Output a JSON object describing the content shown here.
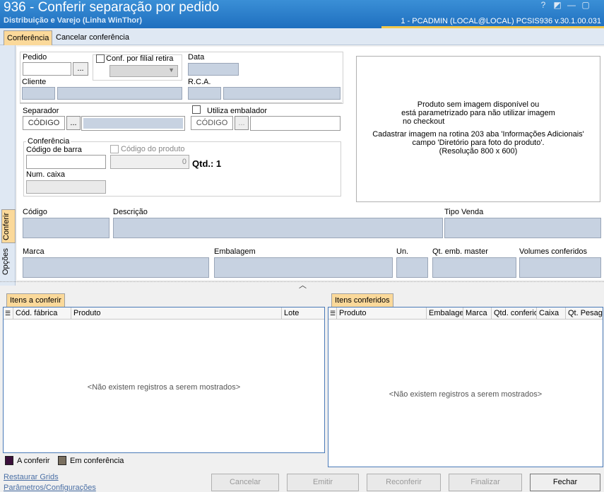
{
  "window": {
    "title": "936 - Conferir separação por pedido",
    "subtitle": "Distribuição e Varejo (Linha WinThor)",
    "session": "1 - PCADMIN (LOCAL@LOCAL)   PCSIS936  v.30.1.00.031",
    "controls": [
      "?",
      "◩",
      "—",
      "▢"
    ]
  },
  "top_tabs": [
    "Conferência",
    "Cancelar conferência"
  ],
  "side_tabs": [
    "Conferir",
    "Opções"
  ],
  "form": {
    "pedido_label": "Pedido",
    "conf_filial_label": "Conf. por filial retira",
    "data_label": "Data",
    "cliente_label": "Cliente",
    "rca_label": "R.C.A.",
    "separador_label": "Separador",
    "separador_codigo": "CÓDIGO",
    "utiliza_embalador_label": "Utiliza embalador",
    "embalador_codigo": "CÓDIGO",
    "conferencia_group": "Conferência",
    "codigo_barra_label": "Código de barra",
    "codigo_produto_label": "Código do produto",
    "codigo_produto_value": "0",
    "qtd_label": "Qtd.: 1",
    "num_caixa_label": "Num. caixa",
    "dots": "...",
    "codigo_label": "Código",
    "descricao_label": "Descrição",
    "tipo_venda_label": "Tipo Venda",
    "marca_label": "Marca",
    "embalagem_label": "Embalagem",
    "un_label": "Un.",
    "qt_emb_master_label": "Qt. emb. master",
    "volumes_conferidos_label": "Volumes conferidos"
  },
  "image_box": {
    "line1": "Produto sem imagem disponível ou",
    "line2": "está parametrizado para não utilizar imagem",
    "line3": "no checkout",
    "line4": "Cadastrar imagem na rotina 203 aba 'Informações Adicionais'",
    "line5": "campo 'Diretório para foto do produto'.",
    "line6": "(Resolução 800 x 600)"
  },
  "grid_left": {
    "tab": "Itens a conferir",
    "columns": [
      "Cód. fábrica",
      "Produto",
      "Lote"
    ],
    "empty": "<Não existem registros a serem mostrados>"
  },
  "grid_right": {
    "tab": "Itens conferidos",
    "columns": [
      "Produto",
      "Embalagem",
      "Marca",
      "Qtd. conferida",
      "Caixa",
      "Qt. Pesagem"
    ],
    "empty": "<Não existem registros a serem mostrados>"
  },
  "legend": [
    {
      "label": "A conferir",
      "color": "#3a0f3a"
    },
    {
      "label": "Em conferência",
      "color": "#7a7060"
    }
  ],
  "links": [
    "Restaurar Grids",
    "Parâmetros/Configurações"
  ],
  "buttons": [
    "Cancelar",
    "Emitir",
    "Reconferir",
    "Finalizar",
    "Fechar"
  ],
  "colors": {
    "titlebar": "#2b7fcc",
    "active_tab": "#fbd99a",
    "readonly_field": "#c7d2e1",
    "grid_border": "#4a7ab8"
  }
}
